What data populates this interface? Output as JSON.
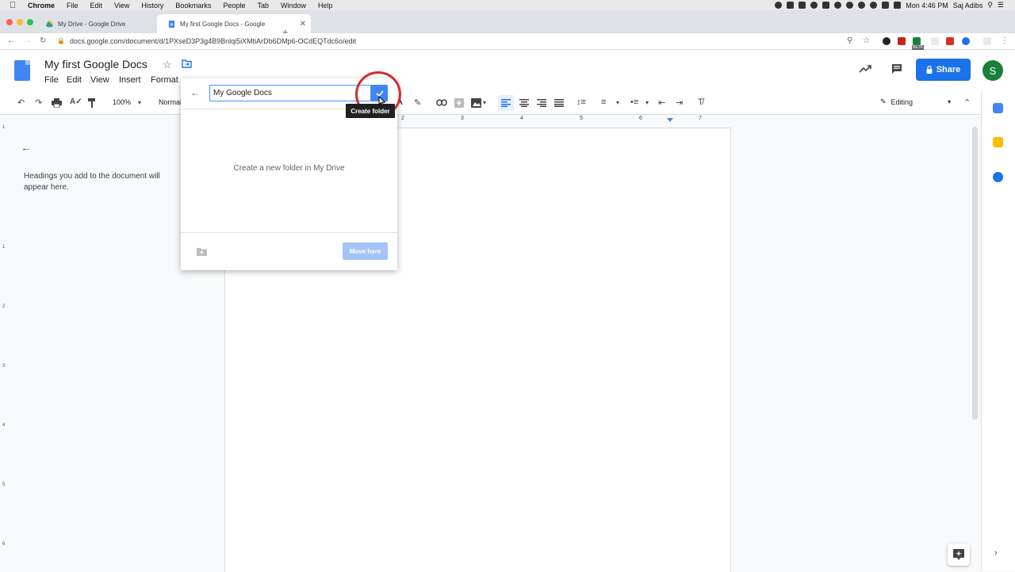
{
  "macos_menu": {
    "app": "Chrome",
    "items": [
      "File",
      "Edit",
      "View",
      "History",
      "Bookmarks",
      "People",
      "Tab",
      "Window",
      "Help"
    ],
    "clock": "Mon 4:46 PM",
    "user": "Saj Adibs"
  },
  "browser": {
    "tabs": [
      {
        "title": "My Drive - Google Drive",
        "close": "✕"
      },
      {
        "title": "My first Google Docs - Google",
        "close": "✕"
      }
    ],
    "new_tab": "+",
    "url": "docs.google.com/document/d/1PXseD3P3g4B9Bnlqi5iXMtiArDb6DMp6-OCdEQTdc6o/edit",
    "beta_badge": "BETA"
  },
  "docs": {
    "title": "My first Google Docs",
    "menu": [
      "File",
      "Edit",
      "View",
      "Insert",
      "Format"
    ],
    "share_label": "Share",
    "avatar_letter": "S",
    "zoom": "100%",
    "style": "Normal",
    "mode": "Editing",
    "ruler_ticks": [
      "2",
      "3",
      "4",
      "5",
      "6",
      "7"
    ],
    "vruler_ticks": [
      "1",
      "1",
      "2",
      "3",
      "4",
      "5",
      "6"
    ],
    "outline_message": "Headings you add to the document will appear here."
  },
  "move_dialog": {
    "folder_name_value": "My Google Docs",
    "empty_message": "Create a new folder in My Drive",
    "move_here_label": "Move here",
    "tooltip": "Create folder"
  },
  "colors": {
    "accent": "#1a73e8",
    "avatar": "#188038",
    "ring": "#d62b2b"
  }
}
